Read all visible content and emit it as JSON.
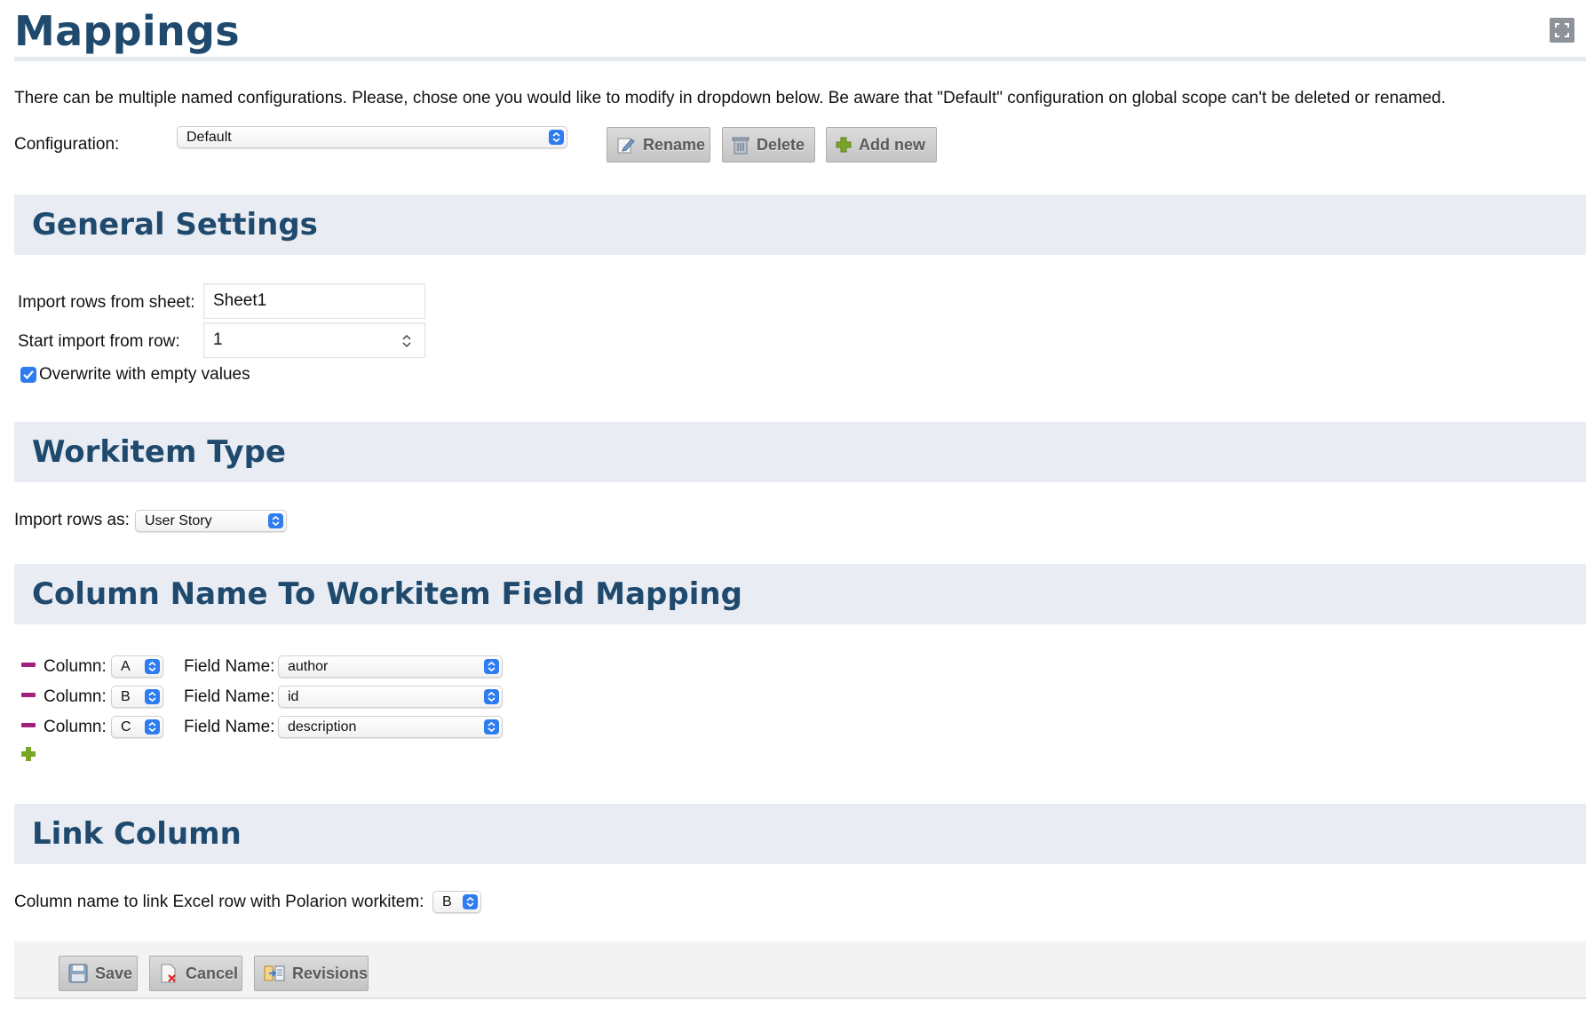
{
  "header": {
    "title": "Mappings",
    "intro": "There can be multiple named configurations. Please, chose one you would like to modify in dropdown below. Be aware that \"Default\" configuration on global scope can't be deleted or renamed."
  },
  "configuration": {
    "label": "Configuration:",
    "selected": "Default",
    "buttons": {
      "rename": "Rename",
      "delete": "Delete",
      "add_new": "Add new"
    }
  },
  "general_settings": {
    "title": "General Settings",
    "sheet_label": "Import rows from sheet:",
    "sheet_value": "Sheet1",
    "row_label": "Start import from row:",
    "row_value": "1",
    "overwrite_label": "Overwrite with empty values",
    "overwrite_checked": true
  },
  "workitem_type": {
    "title": "Workitem Type",
    "label": "Import rows as:",
    "selected": "User Story"
  },
  "column_mapping": {
    "title": "Column Name To Workitem Field Mapping",
    "column_label": "Column:",
    "field_label": "Field Name:",
    "rows": [
      {
        "column": "A",
        "field": "author"
      },
      {
        "column": "B",
        "field": "id"
      },
      {
        "column": "C",
        "field": "description"
      }
    ]
  },
  "link_column": {
    "title": "Link Column",
    "label": "Column name to link Excel row with Polarion workitem:",
    "selected": "B"
  },
  "footer": {
    "save": "Save",
    "cancel": "Cancel",
    "revisions": "Revisions"
  },
  "colors": {
    "heading": "#1f4a6e",
    "section_band": "#e9edf3",
    "accent_blue": "#2f7cf0",
    "remove_magenta": "#a3207d",
    "add_green": "#7aa628"
  }
}
